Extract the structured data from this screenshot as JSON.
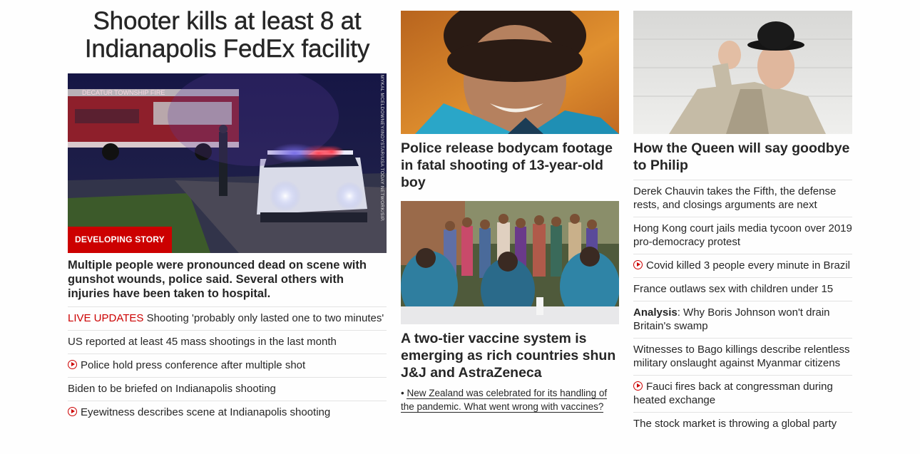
{
  "lead": {
    "headline": "Shooter kills at least 8 at Indianapolis FedEx facility",
    "image_credit": "MYKAL MCELDOWNEY/INDYSTAR/USA TODAY NETWORK/SIPA CONTENT SERVICES",
    "fire_truck_text": "DECATUR TOWNSHIP FIRE",
    "badge": "DEVELOPING STORY",
    "summary": "Multiple people were pronounced dead on scene with gunshot wounds, police said. Several others with injuries have been taken to hospital.",
    "links": [
      {
        "prefix": "LIVE UPDATES",
        "text": " Shooting 'probably only lasted one to two minutes'",
        "icon": "none"
      },
      {
        "prefix": "",
        "text": "US reported at least 45 mass shootings in the last month",
        "icon": "none"
      },
      {
        "prefix": "",
        "text": "Police hold press conference after multiple shot",
        "icon": "play-icon"
      },
      {
        "prefix": "",
        "text": "Biden to be briefed on Indianapolis shooting",
        "icon": "none"
      },
      {
        "prefix": "",
        "text": "Eyewitness describes scene at Indianapolis shooting",
        "icon": "play-icon"
      }
    ]
  },
  "column2": {
    "card1_title": "Police release bodycam footage in fatal shooting of 13-year-old boy",
    "card2_title": "A two-tier vaccine system is emerging as rich countries shun J&J and AstraZeneca",
    "card2_sublink_bullet": "• ",
    "card2_sublink": "New Zealand was celebrated for its handling of the pandemic. What went wrong with vaccines?"
  },
  "column3": {
    "card_title": "How the Queen will say goodbye to Philip",
    "links": [
      {
        "prefix": "",
        "text": "Derek Chauvin takes the Fifth, the defense rests, and closings arguments are next",
        "icon": "none"
      },
      {
        "prefix": "",
        "text": "Hong Kong court jails media tycoon over 2019 pro-democracy protest",
        "icon": "none"
      },
      {
        "prefix": "",
        "text": "Covid killed 3 people every minute in Brazil",
        "icon": "play-icon"
      },
      {
        "prefix": "",
        "text": "France outlaws sex with children under 15",
        "icon": "none"
      },
      {
        "prefix": "Analysis",
        "text": ": Why Boris Johnson won't drain Britain's swamp",
        "icon": "none"
      },
      {
        "prefix": "",
        "text": "Witnesses to Bago killings describe relentless military onslaught against Myanmar citizens",
        "icon": "none"
      },
      {
        "prefix": "",
        "text": "Fauci fires back at congressman during heated exchange",
        "icon": "play-icon"
      },
      {
        "prefix": "",
        "text": "The stock market is throwing a global party",
        "icon": "none"
      }
    ]
  },
  "colors": {
    "accent_red": "#cc0000",
    "text": "#262626",
    "divider": "#e3e3e3"
  }
}
